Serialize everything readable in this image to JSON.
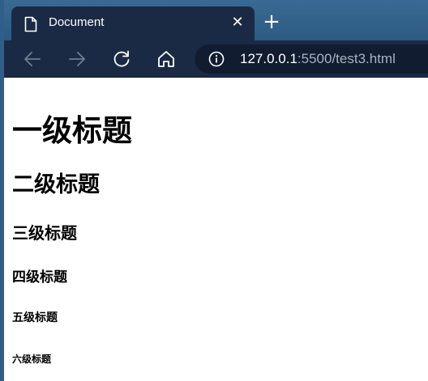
{
  "browser": {
    "tab": {
      "title": "Document",
      "favicon": "document-icon",
      "close_icon": "close-icon"
    },
    "new_tab_icon": "plus-icon",
    "toolbar": {
      "back_icon": "arrow-left-icon",
      "forward_icon": "arrow-right-icon",
      "reload_icon": "reload-icon",
      "home_icon": "home-icon"
    },
    "address": {
      "info_icon": "info-icon",
      "host": "127.0.0.1",
      "rest": ":5500/test3.html"
    },
    "colors": {
      "tabstrip": "#3a6a93",
      "toolbar": "#1b2a44",
      "address_bg": "#111c30",
      "url_rest": "#a7b2c4"
    }
  },
  "page": {
    "h1": "一级标题",
    "h2": "二级标题",
    "h3": "三级标题",
    "h4": "四级标题",
    "h5": "五级标题",
    "h6": "六级标题"
  }
}
